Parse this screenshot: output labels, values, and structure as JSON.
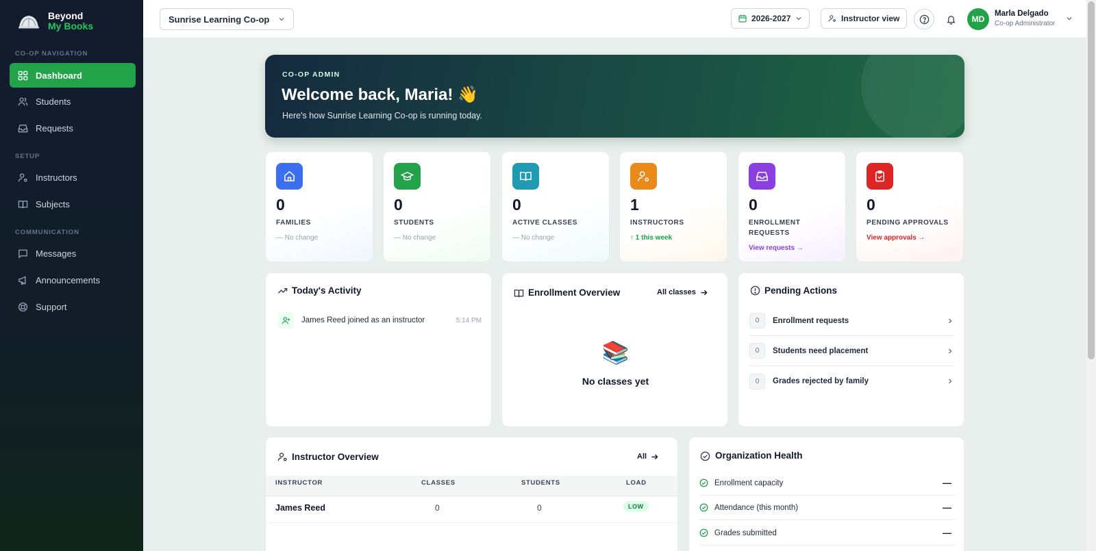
{
  "brand": {
    "line1": "Beyond",
    "line2": "My Books"
  },
  "sidebar": {
    "sections": [
      {
        "label": "CO-OP NAVIGATION"
      },
      {
        "label": "SETUP"
      },
      {
        "label": "COMMUNICATION"
      }
    ],
    "items": [
      {
        "label": "Dashboard",
        "icon": "grid-icon",
        "active": true
      },
      {
        "label": "Students",
        "icon": "users-icon"
      },
      {
        "label": "Requests",
        "icon": "inbox-icon"
      },
      {
        "label": "Instructors",
        "icon": "user-cog-icon"
      },
      {
        "label": "Subjects",
        "icon": "book-icon"
      },
      {
        "label": "Messages",
        "icon": "message-icon"
      },
      {
        "label": "Announcements",
        "icon": "megaphone-icon"
      },
      {
        "label": "Support",
        "icon": "lifebuoy-icon"
      }
    ]
  },
  "topbar": {
    "org": "Sunrise Learning Co-op",
    "year": "2026-2027",
    "instructor_view": "Instructor view",
    "user": {
      "initials": "MD",
      "name": "Marla Delgado",
      "role": "Co-op Administrator"
    }
  },
  "hero": {
    "eyebrow": "CO-OP ADMIN",
    "title": "Welcome back, Maria! 👋",
    "subtitle": "Here's how Sunrise Learning Co-op is running today."
  },
  "stats": [
    {
      "value": "0",
      "label": "FAMILIES",
      "change": "— No change",
      "color": "#3b6ff0"
    },
    {
      "value": "0",
      "label": "STUDENTS",
      "change": "— No change",
      "color": "#22a34a"
    },
    {
      "value": "0",
      "label": "ACTIVE CLASSES",
      "change": "— No change",
      "color": "#1e9bb3"
    },
    {
      "value": "1",
      "label": "INSTRUCTORS",
      "change": "↑ 1 this week",
      "color": "#ea8a1a"
    },
    {
      "value": "0",
      "label": "ENROLLMENT REQUESTS",
      "change": "View requests →",
      "color": "#8b3fe0"
    },
    {
      "value": "0",
      "label": "PENDING APPROVALS",
      "change": "View approvals →",
      "color": "#dc2626"
    }
  ],
  "activity": {
    "title": "Today's Activity",
    "items": [
      {
        "text": "James Reed joined as an instructor",
        "time": "5:14 PM"
      }
    ]
  },
  "enrollment": {
    "title": "Enrollment Overview",
    "link": "All classes",
    "empty_icon": "📚",
    "empty": "No classes yet"
  },
  "pending": {
    "title": "Pending Actions",
    "items": [
      {
        "count": "0",
        "label": "Enrollment requests"
      },
      {
        "count": "0",
        "label": "Students need placement"
      },
      {
        "count": "0",
        "label": "Grades rejected by family"
      }
    ]
  },
  "instructor_overview": {
    "title": "Instructor Overview",
    "link": "All",
    "columns": [
      "INSTRUCTOR",
      "CLASSES",
      "STUDENTS",
      "LOAD"
    ],
    "rows": [
      {
        "name": "James Reed",
        "classes": "0",
        "students": "0",
        "load": "LOW"
      }
    ]
  },
  "org_health": {
    "title": "Organization Health",
    "items": [
      {
        "label": "Enrollment capacity",
        "value": "—"
      },
      {
        "label": "Attendance (this month)",
        "value": "—"
      },
      {
        "label": "Grades submitted",
        "value": "—"
      }
    ]
  }
}
